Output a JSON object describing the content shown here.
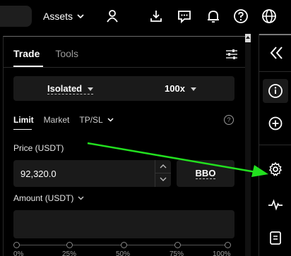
{
  "topbar": {
    "assets_label": "Assets",
    "icons": [
      "user-icon",
      "download-icon",
      "chat-icon",
      "bell-icon",
      "help-icon",
      "globe-icon"
    ]
  },
  "panel": {
    "tabs": [
      {
        "label": "Trade",
        "active": true
      },
      {
        "label": "Tools",
        "active": false
      }
    ],
    "margin_mode": "Isolated",
    "leverage": "100x",
    "order_types": [
      {
        "label": "Limit",
        "active": true
      },
      {
        "label": "Market",
        "active": false
      },
      {
        "label": "TP/SL",
        "active": false
      }
    ],
    "help_glyph": "?",
    "price": {
      "label": "Price (USDT)",
      "value": "92,320.0",
      "bbo_label": "BBO"
    },
    "amount": {
      "label": "Amount (USDT)",
      "value": ""
    },
    "slider": {
      "ticks": [
        "0%",
        "25%",
        "50%",
        "75%",
        "100%"
      ],
      "value_fraction": 0
    }
  },
  "sidebar": {
    "buttons": [
      "collapse-icon",
      "info-icon",
      "add-icon",
      "settings-icon",
      "activity-icon",
      "clipboard-icon"
    ]
  },
  "colors": {
    "background": "#000000",
    "panel_field": "#1a1a1a",
    "annotation_arrow": "#22e01f"
  }
}
